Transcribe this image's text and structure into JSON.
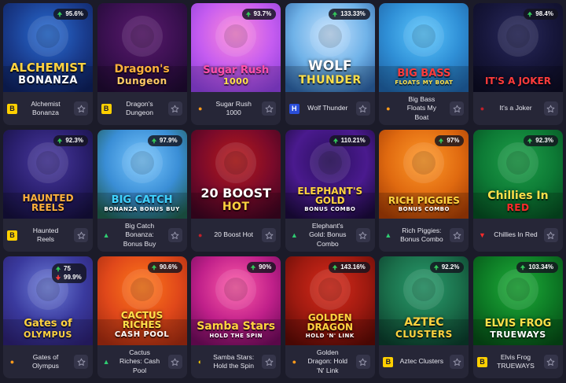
{
  "games": [
    {
      "name": "Alchemist Bonanza",
      "art": "ALCHEMIST",
      "art_sub": "BONANZA",
      "rtp": "95.6%",
      "provider": "bgaming",
      "theme": "alchemist"
    },
    {
      "name": "Dragon's Dungeon",
      "art": "Dragon's",
      "art_sub": "Dungeon",
      "rtp": "",
      "provider": "bgaming",
      "theme": "dragon"
    },
    {
      "name": "Sugar Rush 1000",
      "art": "Sugar Rush",
      "art_sub": "1000",
      "rtp": "93.7%",
      "provider": "pragmatic",
      "theme": "sugar"
    },
    {
      "name": "Wolf Thunder",
      "art": "WOLF",
      "art_sub": "THUNDER",
      "rtp": "133.33%",
      "provider": "blueprint",
      "theme": "wolf"
    },
    {
      "name": "Big Bass Floats My Boat",
      "art": "BIG BASS",
      "art_sub": "FLOATS MY BOAT",
      "rtp": "",
      "provider": "pragmatic",
      "theme": "bass"
    },
    {
      "name": "It's a Joker",
      "art": "IT'S A JOKER",
      "art_sub": "",
      "rtp": "98.4%",
      "provider": "redcircle",
      "theme": "joker"
    },
    {
      "name": "Haunted Reels",
      "art": "HAUNTED REELS",
      "art_sub": "",
      "rtp": "92.3%",
      "provider": "bgaming",
      "theme": "haunted"
    },
    {
      "name": "Big Catch Bonanza: Bonus Buy",
      "art": "BIG CATCH",
      "art_sub": "BONANZA BONUS BUY",
      "rtp": "97.9%",
      "provider": "greentri",
      "theme": "catch"
    },
    {
      "name": "20 Boost Hot",
      "art": "20 BOOST",
      "art_sub": "HOT",
      "rtp": "",
      "provider": "redcircle",
      "theme": "boost"
    },
    {
      "name": "Elephant's Gold: Bonus Combo",
      "art": "ELEPHANT'S GOLD",
      "art_sub": "BONUS COMBO",
      "rtp": "110.21%",
      "provider": "greentri",
      "theme": "elephant"
    },
    {
      "name": "Rich Piggies: Bonus Combo",
      "art": "RICH PIGGIES",
      "art_sub": "BONUS COMBO",
      "rtp": "97%",
      "provider": "greentri",
      "theme": "piggies"
    },
    {
      "name": "Chillies In Red",
      "art": "Chillies In",
      "art_sub": "RED",
      "rtp": "92.3%",
      "provider": "redtri",
      "theme": "chillies"
    },
    {
      "name": "Gates of Olympus",
      "art": "Gates of",
      "art_sub": "OLYMPUS",
      "rtp": "",
      "rtp_a": "75",
      "rtp_b": "99.9%",
      "provider": "pragmatic",
      "theme": "olympus"
    },
    {
      "name": "Cactus Riches: Cash Pool",
      "art": "CACTUS RICHES",
      "art_sub": "CASH POOL",
      "rtp": "90.6%",
      "provider": "greentri",
      "theme": "cactus"
    },
    {
      "name": "Samba Stars: Hold the Spin",
      "art": "Samba Stars",
      "art_sub": "HOLD THE SPIN",
      "rtp": "90%",
      "provider": "gamzix",
      "theme": "samba"
    },
    {
      "name": "Golden Dragon: Hold 'N' Link",
      "art": "GOLDEN DRAGON",
      "art_sub": "HOLD 'N' LINK",
      "rtp": "143.16%",
      "provider": "pragmatic",
      "theme": "golden"
    },
    {
      "name": "Aztec Clusters",
      "art": "AZTEC",
      "art_sub": "CLUSTERS",
      "rtp": "92.2%",
      "provider": "bgaming",
      "theme": "aztec"
    },
    {
      "name": "Elvis Frog TRUEWAYS",
      "art": "ELVIS FROG",
      "art_sub": "TRUEWAYS",
      "rtp": "103.34%",
      "provider": "bgaming",
      "theme": "elvis"
    }
  ],
  "icons": {
    "favorite": "star-outline-icon",
    "rtp_up": "arrow-up-icon",
    "rtp_down": "arrow-down-icon"
  },
  "colors": {
    "page_bg": "#1b1b29",
    "card_bg": "#262637",
    "accent_green": "#34c759",
    "accent_red": "#ff3b3b"
  }
}
